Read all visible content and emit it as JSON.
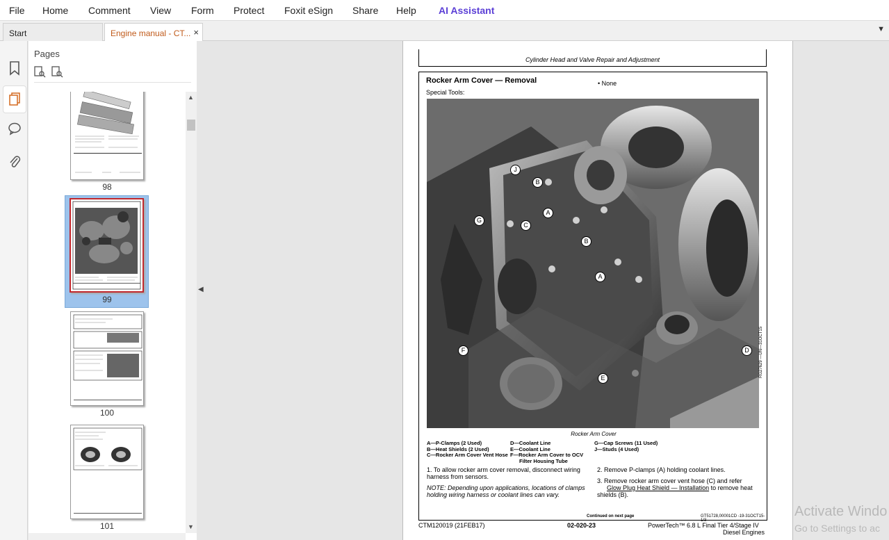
{
  "menu": [
    "File",
    "Home",
    "Comment",
    "View",
    "Form",
    "Protect",
    "Foxit eSign",
    "Share",
    "Help",
    "AI Assistant"
  ],
  "tabs": {
    "start": "Start",
    "doc": "Engine manual - CT...",
    "close": "×",
    "dropdown": "▼"
  },
  "left_rail": {
    "icons": [
      "bookmark-icon",
      "pages-icon",
      "comment-icon",
      "attachment-icon"
    ]
  },
  "pages_panel": {
    "title": "Pages",
    "thumbnails": [
      {
        "label": "98"
      },
      {
        "label": "99",
        "selected": true
      },
      {
        "label": "100"
      },
      {
        "label": "101"
      }
    ]
  },
  "document": {
    "header": "Cylinder Head and Valve Repair and Adjustment",
    "section_title": "Rocker Arm Cover — Removal",
    "special_tools": "Special Tools:",
    "tool_none": "• None",
    "figure_code": "RG27629 —UN—31OCT15",
    "figure_caption": "Rocker Arm Cover",
    "callouts": [
      "J",
      "B",
      "A",
      "G",
      "C",
      "B",
      "A",
      "F",
      "E",
      "D"
    ],
    "legend": {
      "col1": [
        "A—P-Clamps (2 Used)",
        "B—Heat Shields (2 Used)",
        "C—Rocker Arm Cover Vent Hose"
      ],
      "col2": [
        "D—Coolant Line",
        "E—Coolant Line",
        "F—Rocker Arm Cover to OCV",
        "Filter Housing Tube"
      ],
      "col3": [
        "G—Cap Screws (11 Used)",
        "J—Studs (4 Used)"
      ]
    },
    "step1": "1.   To allow rocker arm cover removal, disconnect wiring harness from sensors.",
    "note": "NOTE: Depending upon applications, locations of clamps holding wiring harness or coolant lines can vary.",
    "step2": "2.   Remove P-clamps (A) holding coolant lines.",
    "step3_pre": "3.   Remove rocker arm cover vent hose (C) and refer",
    "step3_link": "Glow Plug Heat Shield — Installation",
    "step3_post": " to remove heat shields (B).",
    "continued": "Continued on next page",
    "doc_ref": "GT51728,00001CD -19-31OCT15-1/3",
    "footer_left": "CTM120019 (21FEB17)",
    "footer_center": "02-020-23",
    "footer_right": "PowerTech™ 6.8 L Final Tier 4/Stage IV",
    "footer_right2": "Diesel Engines"
  },
  "watermark": {
    "line1": "Activate Windo",
    "line2": "Go to Settings to ac"
  }
}
